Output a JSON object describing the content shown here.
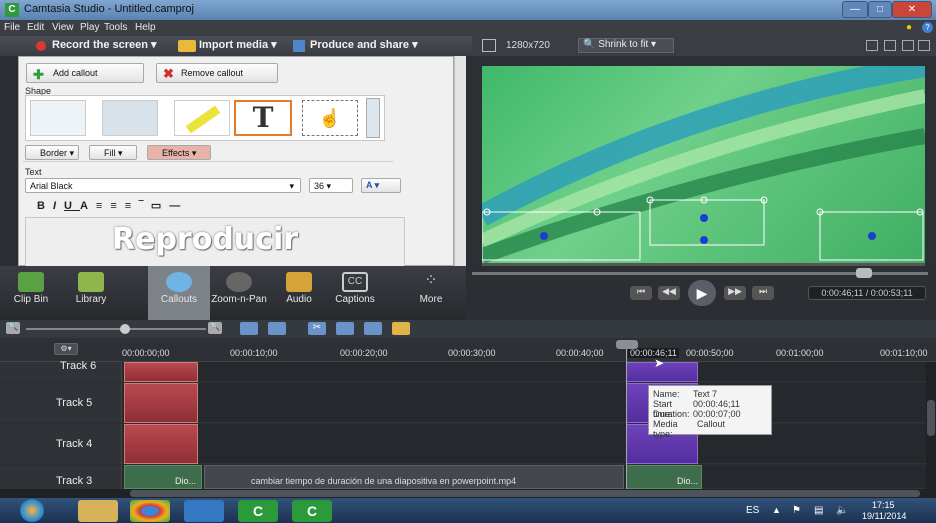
{
  "window": {
    "title": "Camtasia Studio - Untitled.camproj",
    "app_icon": "C"
  },
  "menu": [
    "File",
    "Edit",
    "View",
    "Play",
    "Tools",
    "Help"
  ],
  "toolbar": {
    "record": "Record the screen ▾",
    "import": "Import media ▾",
    "produce": "Produce and share ▾"
  },
  "canvas": {
    "resolution": "1280x720",
    "zoom": "Shrink to fit"
  },
  "callouts": {
    "add": "Add callout",
    "remove": "Remove callout",
    "shape_label": "Shape",
    "border": "Border",
    "fill": "Fill",
    "effects": "Effects",
    "text_label": "Text",
    "font": "Arial Black",
    "size": "36",
    "format_buttons": [
      "B",
      "I",
      "U",
      "A",
      "≡",
      "≡",
      "≡",
      "‾",
      "▭",
      "—"
    ],
    "editor_text": "Reproducir"
  },
  "tabs": [
    {
      "label": "Clip Bin",
      "icon": "film-icon"
    },
    {
      "label": "Library",
      "icon": "library-icon"
    },
    {
      "label": "Callouts",
      "icon": "callout-icon"
    },
    {
      "label": "Zoom-n-Pan",
      "icon": "zoom-icon"
    },
    {
      "label": "Audio",
      "icon": "audio-icon"
    },
    {
      "label": "Captions",
      "icon": "cc-icon"
    },
    {
      "label": "More",
      "icon": "more-icon"
    }
  ],
  "player": {
    "time": "0:00:46;11 / 0:00:53;11"
  },
  "ruler": [
    "00:00:00;00",
    "00:00:10;00",
    "00:00:20;00",
    "00:00:30;00",
    "00:00:40;00",
    "00:00:46;11",
    "00:00:50;00",
    "00:01:00;00",
    "00:01:10;00"
  ],
  "tracks": [
    "Track 6",
    "Track 5",
    "Track 4",
    "Track 3"
  ],
  "track3_clips": [
    "Dio...",
    "cambiar tiempo de duración de una diapositiva en powerpoint.mp4",
    "Dio..."
  ],
  "tooltip": {
    "name_k": "Name:",
    "name_v": "Text 7",
    "start_k": "Start time:",
    "start_v": "00:00:46;11",
    "dur_k": "Duration:",
    "dur_v": "00:00:07;00",
    "type_k": "Media type:",
    "type_v": "Callout"
  },
  "tray": {
    "lang": "ES",
    "time": "17:15",
    "date": "19/11/2014"
  }
}
